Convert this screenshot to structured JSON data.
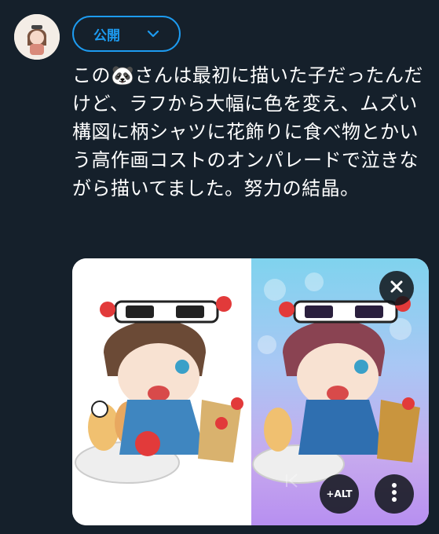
{
  "composer": {
    "audience_label": "公開",
    "tweet_text": "この🐼さんは最初に描いた子だったんだけど、ラフから大幅に色を変え、ムズい構図に柄シャツに花飾りに食べ物とかいう高作画コストのオンパレードで泣きながら描いてました。努力の結晶。"
  },
  "media": {
    "alt_label": "+ALT",
    "icons": {
      "close": "close-icon",
      "more": "more-vertical-icon",
      "previous": "previous-icon",
      "audience_chevron": "chevron-down-icon"
    }
  },
  "colors": {
    "background": "#15202b",
    "accent": "#1d9bf0",
    "text": "#ffffff"
  }
}
